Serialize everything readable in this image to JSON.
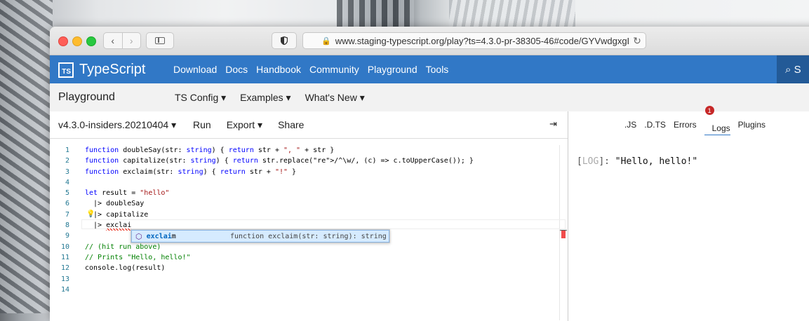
{
  "browser": {
    "url": "www.staging-typescript.org/play?ts=4.3.0-pr-38305-46#code/GYVwdgxgL"
  },
  "site_nav": {
    "brand_badge": "TS",
    "brand": "TypeScript",
    "links": [
      "Download",
      "Docs",
      "Handbook",
      "Community",
      "Playground",
      "Tools"
    ],
    "search_label": "S"
  },
  "playground_bar": {
    "title": "Playground",
    "menus": [
      "TS Config ▾",
      "Examples ▾",
      "What's New ▾"
    ]
  },
  "editor_toolbar": {
    "version": "v4.3.0-insiders.20210404 ▾",
    "run": "Run",
    "export": "Export ▾",
    "share": "Share",
    "collapse_icon": "⇥"
  },
  "code_lines": [
    {
      "n": "1",
      "text": "function doubleSay(str: string) { return str + \", \" + str }"
    },
    {
      "n": "2",
      "text": "function capitalize(str: string) { return str.replace(/^\\w/, (c) => c.toUpperCase()); }"
    },
    {
      "n": "3",
      "text": "function exclaim(str: string) { return str + \"!\" }"
    },
    {
      "n": "4",
      "text": ""
    },
    {
      "n": "5",
      "text": "let result = \"hello\""
    },
    {
      "n": "6",
      "text": "  |> doubleSay"
    },
    {
      "n": "7",
      "text": "  |> capitalize"
    },
    {
      "n": "8",
      "text": "  |> exclai"
    },
    {
      "n": "9",
      "text": ""
    },
    {
      "n": "10",
      "text": "// (hit run above)"
    },
    {
      "n": "11",
      "text": "// Prints \"Hello, hello!\""
    },
    {
      "n": "12",
      "text": "console.log(result)"
    },
    {
      "n": "13",
      "text": ""
    },
    {
      "n": "14",
      "text": ""
    }
  ],
  "autocomplete": {
    "match": "exclai",
    "rest": "m",
    "detail": "function exclaim(str: string): string"
  },
  "right_tabs": {
    "items": [
      ".JS",
      ".D.TS",
      "Errors",
      "Logs",
      "Plugins"
    ],
    "active": "Logs",
    "logs_badge": "1"
  },
  "log_output": {
    "open": "[",
    "level": "LOG",
    "close": "]: ",
    "message": "\"Hello, hello!\""
  },
  "colors": {
    "ts_blue": "#3178c6",
    "error": "#f14c4c",
    "badge": "#c62828"
  }
}
